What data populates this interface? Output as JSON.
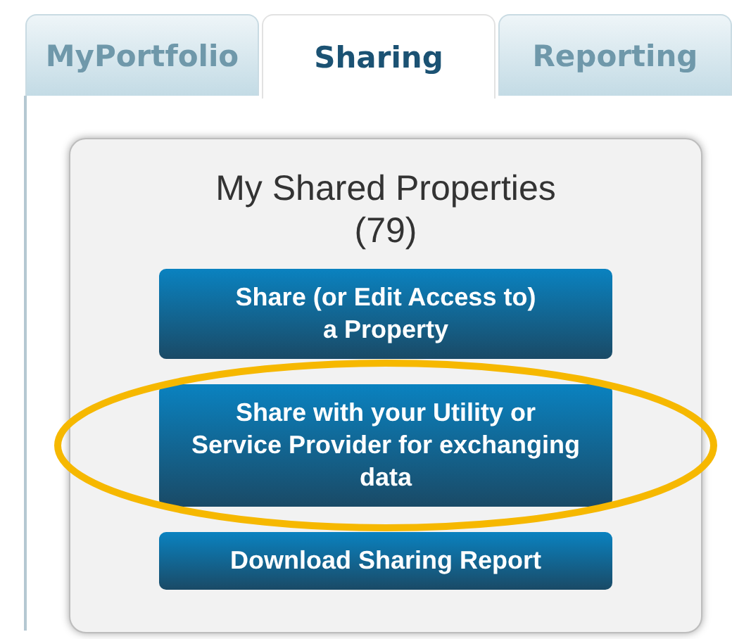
{
  "tabs": [
    {
      "label": "MyPortfolio",
      "selected": false
    },
    {
      "label": "Sharing",
      "selected": true
    },
    {
      "label": "Reporting",
      "selected": false
    }
  ],
  "panel": {
    "title": "My Shared Properties",
    "count": "(79)",
    "buttons": [
      {
        "label": "Share (or Edit Access to)\na Property"
      },
      {
        "label": "Share with your Utility or\nService Provider for exchanging\ndata",
        "highlighted": true
      },
      {
        "label": "Download Sharing Report"
      }
    ]
  }
}
